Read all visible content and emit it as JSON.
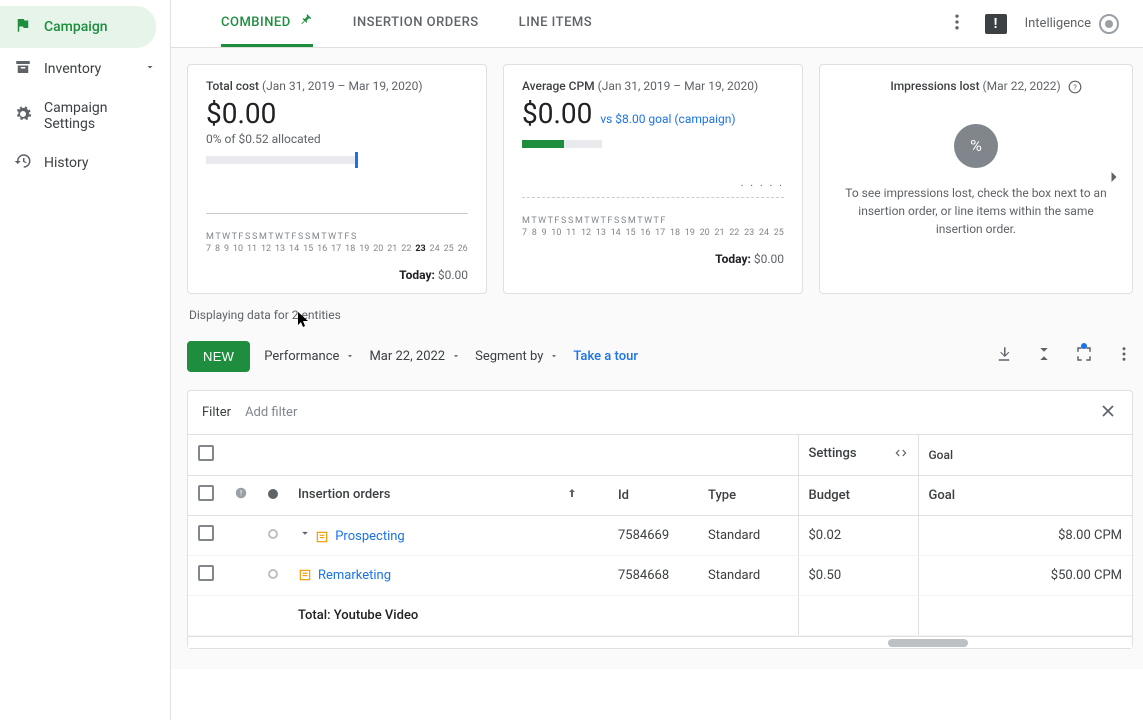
{
  "sidebar": {
    "items": [
      {
        "label": "Campaign"
      },
      {
        "label": "Inventory"
      },
      {
        "label": "Campaign Settings"
      },
      {
        "label": "History"
      }
    ]
  },
  "tabs": {
    "combined": "COMBINED",
    "io": "INSERTION ORDERS",
    "li": "LINE ITEMS"
  },
  "topright": {
    "intelligence": "Intelligence",
    "feedback": "!"
  },
  "card_cost": {
    "title_bold": "Total cost",
    "title_date": "(Jan 31, 2019 – Mar 19, 2020)",
    "value": "$0.00",
    "alloc": "0% of $0.52 allocated",
    "days": "M T W T F S S M T W T F S S M T W T F S",
    "nums": [
      "7",
      "8",
      "9",
      "10",
      "11",
      "12",
      "13",
      "14",
      "15",
      "16",
      "17",
      "18",
      "19",
      "20",
      "21",
      "22",
      "23",
      "24",
      "25",
      "26"
    ],
    "today_lbl": "Today:",
    "today_val": " $0.00"
  },
  "card_cpm": {
    "title_bold": "Average CPM",
    "title_date": "(Jan 31, 2019 – Mar 19, 2020)",
    "value": "$0.00",
    "goal": "vs $8.00 goal (campaign)",
    "spark_val": ". . . . .",
    "days": "M T W T F S S M T W T F S S M T W T F",
    "nums": [
      "7",
      "8",
      "9",
      "10",
      "11",
      "12",
      "13",
      "14",
      "15",
      "16",
      "17",
      "18",
      "19",
      "20",
      "21",
      "22",
      "23",
      "24",
      "25"
    ],
    "today_lbl": "Today:",
    "today_val": " $0.00"
  },
  "card_imp": {
    "title_bold": "Impressions lost",
    "title_date": "(Mar 22, 2022)",
    "circle": "%",
    "text": "To see impressions lost, check the box next to an insertion order, or line items within the same insertion order."
  },
  "meta": "Displaying data for 2 entities",
  "toolbar": {
    "new": "NEW",
    "perf": "Performance",
    "date": "Mar 22, 2022",
    "seg": "Segment by",
    "tour": "Take a tour"
  },
  "filter": {
    "label": "Filter",
    "add": "Add filter"
  },
  "headers_top": {
    "settings": "Settings",
    "goal": "Goal"
  },
  "headers_sec": {
    "io": "Insertion orders",
    "id": "Id",
    "type": "Type",
    "budget": "Budget",
    "goal": "Goal"
  },
  "rows": [
    {
      "name": "Prospecting",
      "id": "7584669",
      "type": "Standard",
      "budget": "$0.02",
      "goal": "$8.00 CPM"
    },
    {
      "name": "Remarketing",
      "id": "7584668",
      "type": "Standard",
      "budget": "$0.50",
      "goal": "$50.00 CPM"
    }
  ],
  "total": "Total: Youtube Video",
  "chart_data": [
    {
      "type": "line",
      "title": "Total cost",
      "x": [
        7,
        8,
        9,
        10,
        11,
        12,
        13,
        14,
        15,
        16,
        17,
        18,
        19,
        20,
        21,
        22,
        23,
        24,
        25,
        26
      ],
      "values": [
        0,
        0,
        0,
        0,
        0,
        0,
        0,
        0,
        0,
        0,
        0,
        0,
        0,
        0,
        0,
        0,
        0,
        0,
        0,
        0
      ],
      "today": 0,
      "allocated_pct": 0,
      "allocated_of": 0.52
    },
    {
      "type": "line",
      "title": "Average CPM",
      "x": [
        7,
        8,
        9,
        10,
        11,
        12,
        13,
        14,
        15,
        16,
        17,
        18,
        19,
        20,
        21,
        22,
        23,
        24,
        25
      ],
      "values": [
        0,
        0,
        0,
        0,
        0,
        0,
        0,
        0,
        0,
        0,
        0,
        0,
        0,
        0,
        0,
        0,
        0,
        0,
        0
      ],
      "today": 0,
      "goal": 8.0
    }
  ]
}
